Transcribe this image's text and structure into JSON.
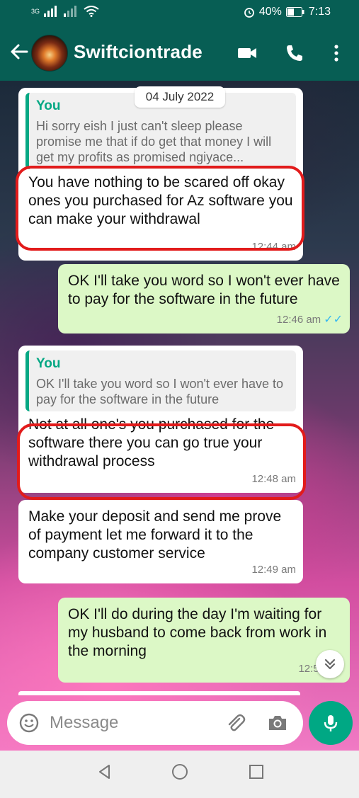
{
  "status_bar": {
    "network": "3G",
    "battery_percent": "40%",
    "time": "7:13"
  },
  "header": {
    "contact_name": "Swiftciontrade"
  },
  "date_chip": "04 July 2022",
  "messages": [
    {
      "direction": "incoming",
      "quote_author": "You",
      "quote_text": "Hi sorry eish I just can't sleep please promise me that if do get that money I will get my profits as promised ngiyace...",
      "text": "You have nothing to be scared off okay ones you purchased for Az software you can make your withdrawal",
      "time": "12:44 am",
      "highlighted": true
    },
    {
      "direction": "outgoing",
      "text": "OK I'll take you word so I won't ever have to pay for the software in the future",
      "time": "12:46 am",
      "status": "read"
    },
    {
      "direction": "incoming",
      "quote_author": "You",
      "quote_text": "OK I'll take you word so I won't ever have to pay for the software in the future",
      "text": "Not at all one's you purchased for the software there you can go true your withdrawal process",
      "time": "12:48 am",
      "highlighted": true
    },
    {
      "direction": "incoming",
      "text": "Make your deposit and send me prove of payment let me forward it to the company customer service",
      "time": "12:49 am"
    },
    {
      "direction": "outgoing",
      "text": "OK I'll do during the day I'm waiting for my husband to come back from work in the morning",
      "time": "12:50 am"
    }
  ],
  "composer": {
    "placeholder": "Message"
  },
  "colors": {
    "header": "#075e54",
    "accent": "#00a884",
    "outgoing_bubble": "#dcf8c6",
    "highlight_ring": "#e21b1b",
    "read_ticks": "#34b7f1"
  }
}
